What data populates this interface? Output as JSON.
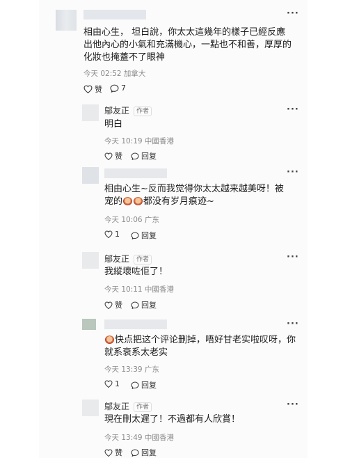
{
  "top_comment": {
    "text": "相由心生， 坦白說，你太太這幾年的樣子已經反應出他內心的小氣和充滿機心，一點也不和善，厚厚的化妝也掩蓋不了眼神",
    "meta": "今天 02:52 加拿大",
    "like": "赞",
    "reply_count": "7"
  },
  "replies": [
    {
      "name": "鄔友正",
      "tag": "作者",
      "text": "明白",
      "meta": "今天 10:19 中國香港",
      "like": "赞",
      "reply": "回复"
    },
    {
      "text_a": "相由心生~反而我觉得你太太越来越美呀！被宠的",
      "text_b": "都没有岁月痕迹~",
      "meta": "今天 10:06 广东",
      "reply_count": "1",
      "reply": "回复"
    },
    {
      "name": "鄔友正",
      "tag": "作者",
      "text": "我縱壞咗佢了！",
      "meta": "今天 10:11 中國香港",
      "like": "赞",
      "reply": "回复"
    },
    {
      "text": "快点把这个评论删掉，唔好甘老实啦叹呀，你就系衰系太老实",
      "meta": "今天 13:39 广东",
      "reply_count": "1",
      "reply": "回复"
    },
    {
      "name": "鄔友正",
      "tag": "作者",
      "text": "現在刪太遲了！不過都有人欣賞！",
      "meta": "今天 13:49 中國香港",
      "like": "赞",
      "reply": "回复"
    }
  ],
  "icons": [
    "more-icon",
    "heart-icon",
    "comment-icon"
  ]
}
